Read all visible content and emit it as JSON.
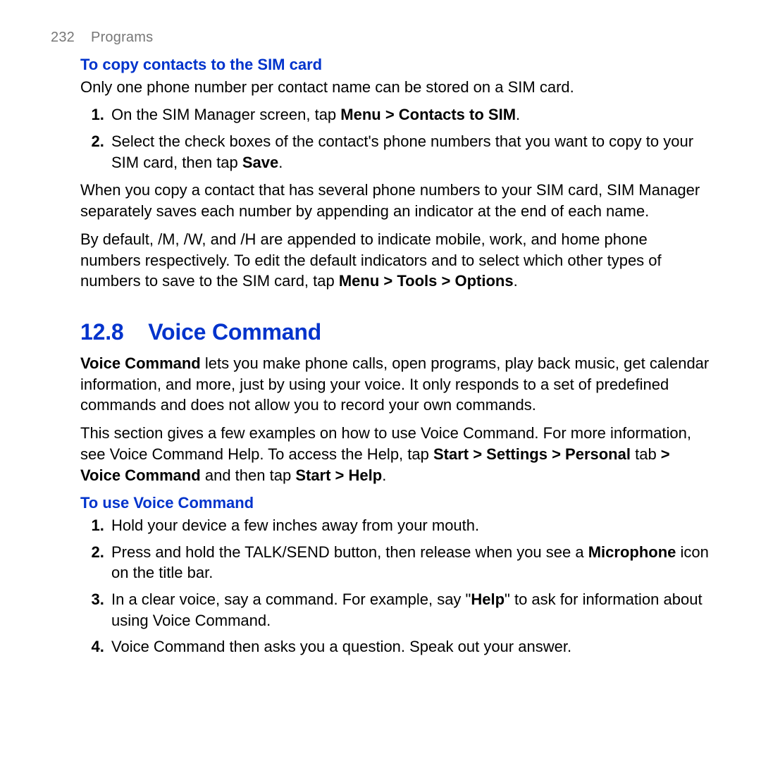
{
  "header": {
    "page": "232",
    "chapter": "Programs"
  },
  "blue": "#0033cc",
  "simSection": {
    "heading": "To copy contacts to the SIM card",
    "intro": "Only one phone number per contact name can be stored on a SIM card.",
    "steps": [
      [
        {
          "t": "On the SIM Manager screen, tap "
        },
        {
          "t": "Menu > Contacts to SIM",
          "b": true
        },
        {
          "t": "."
        }
      ],
      [
        {
          "t": "Select the check boxes of the contact's phone numbers that you want to copy to your SIM card, then tap "
        },
        {
          "t": "Save",
          "b": true
        },
        {
          "t": "."
        }
      ]
    ],
    "para1": "When you copy a contact that has several phone numbers to your SIM card, SIM Manager separately saves each number by appending an indicator at the end of each name.",
    "para2": [
      {
        "t": "By default, /M, /W, and /H are appended to indicate mobile, work, and home phone numbers respectively. To edit the default indicators and to select which other types of numbers to save to the SIM card, tap "
      },
      {
        "t": "Menu > Tools > Options",
        "b": true
      },
      {
        "t": "."
      }
    ]
  },
  "voiceSection": {
    "number": "12.8",
    "title": "Voice Command",
    "intro1": [
      {
        "t": "Voice Command",
        "b": true
      },
      {
        "t": " lets you make phone calls, open programs, play back music, get calendar information, and more, just by using your voice. It only responds to a set of predefined commands and does not allow you to record your own commands."
      }
    ],
    "intro2": [
      {
        "t": "This section gives a few examples on how to use Voice Command. For more information, see Voice Command Help. To access the Help, tap "
      },
      {
        "t": "Start > Settings > Personal ",
        "b": true
      },
      {
        "t": "tab"
      },
      {
        "t": " > Voice Command ",
        "b": true
      },
      {
        "t": "and then tap "
      },
      {
        "t": "Start > Help",
        "b": true
      },
      {
        "t": "."
      }
    ],
    "useHeading": "To use Voice Command",
    "useSteps": [
      [
        {
          "t": "Hold your device a few inches away from your mouth."
        }
      ],
      [
        {
          "t": "Press and hold the TALK/SEND button, then release when you see a "
        },
        {
          "t": "Microphone",
          "b": true
        },
        {
          "t": " icon on the title bar."
        }
      ],
      [
        {
          "t": "In a clear voice, say a command. For example, say \""
        },
        {
          "t": "Help",
          "b": true
        },
        {
          "t": "\" to ask for information about using Voice Command."
        }
      ],
      [
        {
          "t": "Voice Command then asks you a question. Speak out your answer."
        }
      ]
    ]
  }
}
